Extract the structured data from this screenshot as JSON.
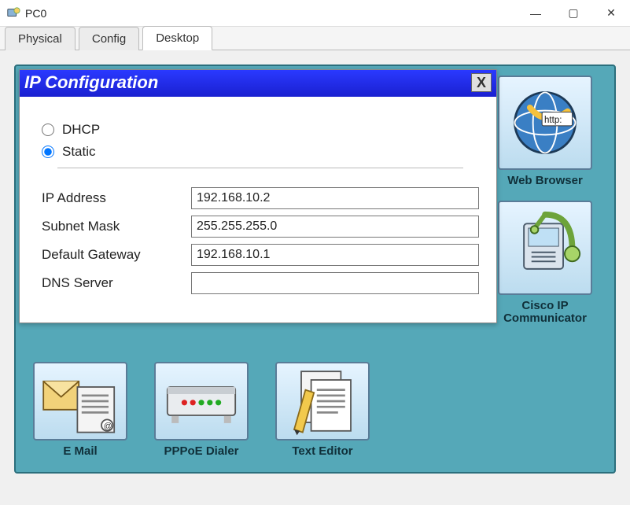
{
  "window": {
    "title": "PC0",
    "minimize": "—",
    "maximize": "▢",
    "close": "✕"
  },
  "tabs": [
    {
      "label": "Physical",
      "active": false
    },
    {
      "label": "Config",
      "active": false
    },
    {
      "label": "Desktop",
      "active": true
    }
  ],
  "ip_config": {
    "title": "IP Configuration",
    "close_label": "X",
    "mode": "static",
    "radios": {
      "dhcp": "DHCP",
      "static": "Static"
    },
    "fields": {
      "ip_address": {
        "label": "IP Address",
        "value": "192.168.10.2"
      },
      "subnet_mask": {
        "label": "Subnet Mask",
        "value": "255.255.255.0"
      },
      "gateway": {
        "label": "Default Gateway",
        "value": "192.168.10.1"
      },
      "dns": {
        "label": "DNS Server",
        "value": ""
      }
    }
  },
  "apps": {
    "web_browser": "Web Browser",
    "cisco_ip": "Cisco IP Communicator",
    "email": "E Mail",
    "pppoe": "PPPoE Dialer",
    "text_editor": "Text Editor"
  }
}
